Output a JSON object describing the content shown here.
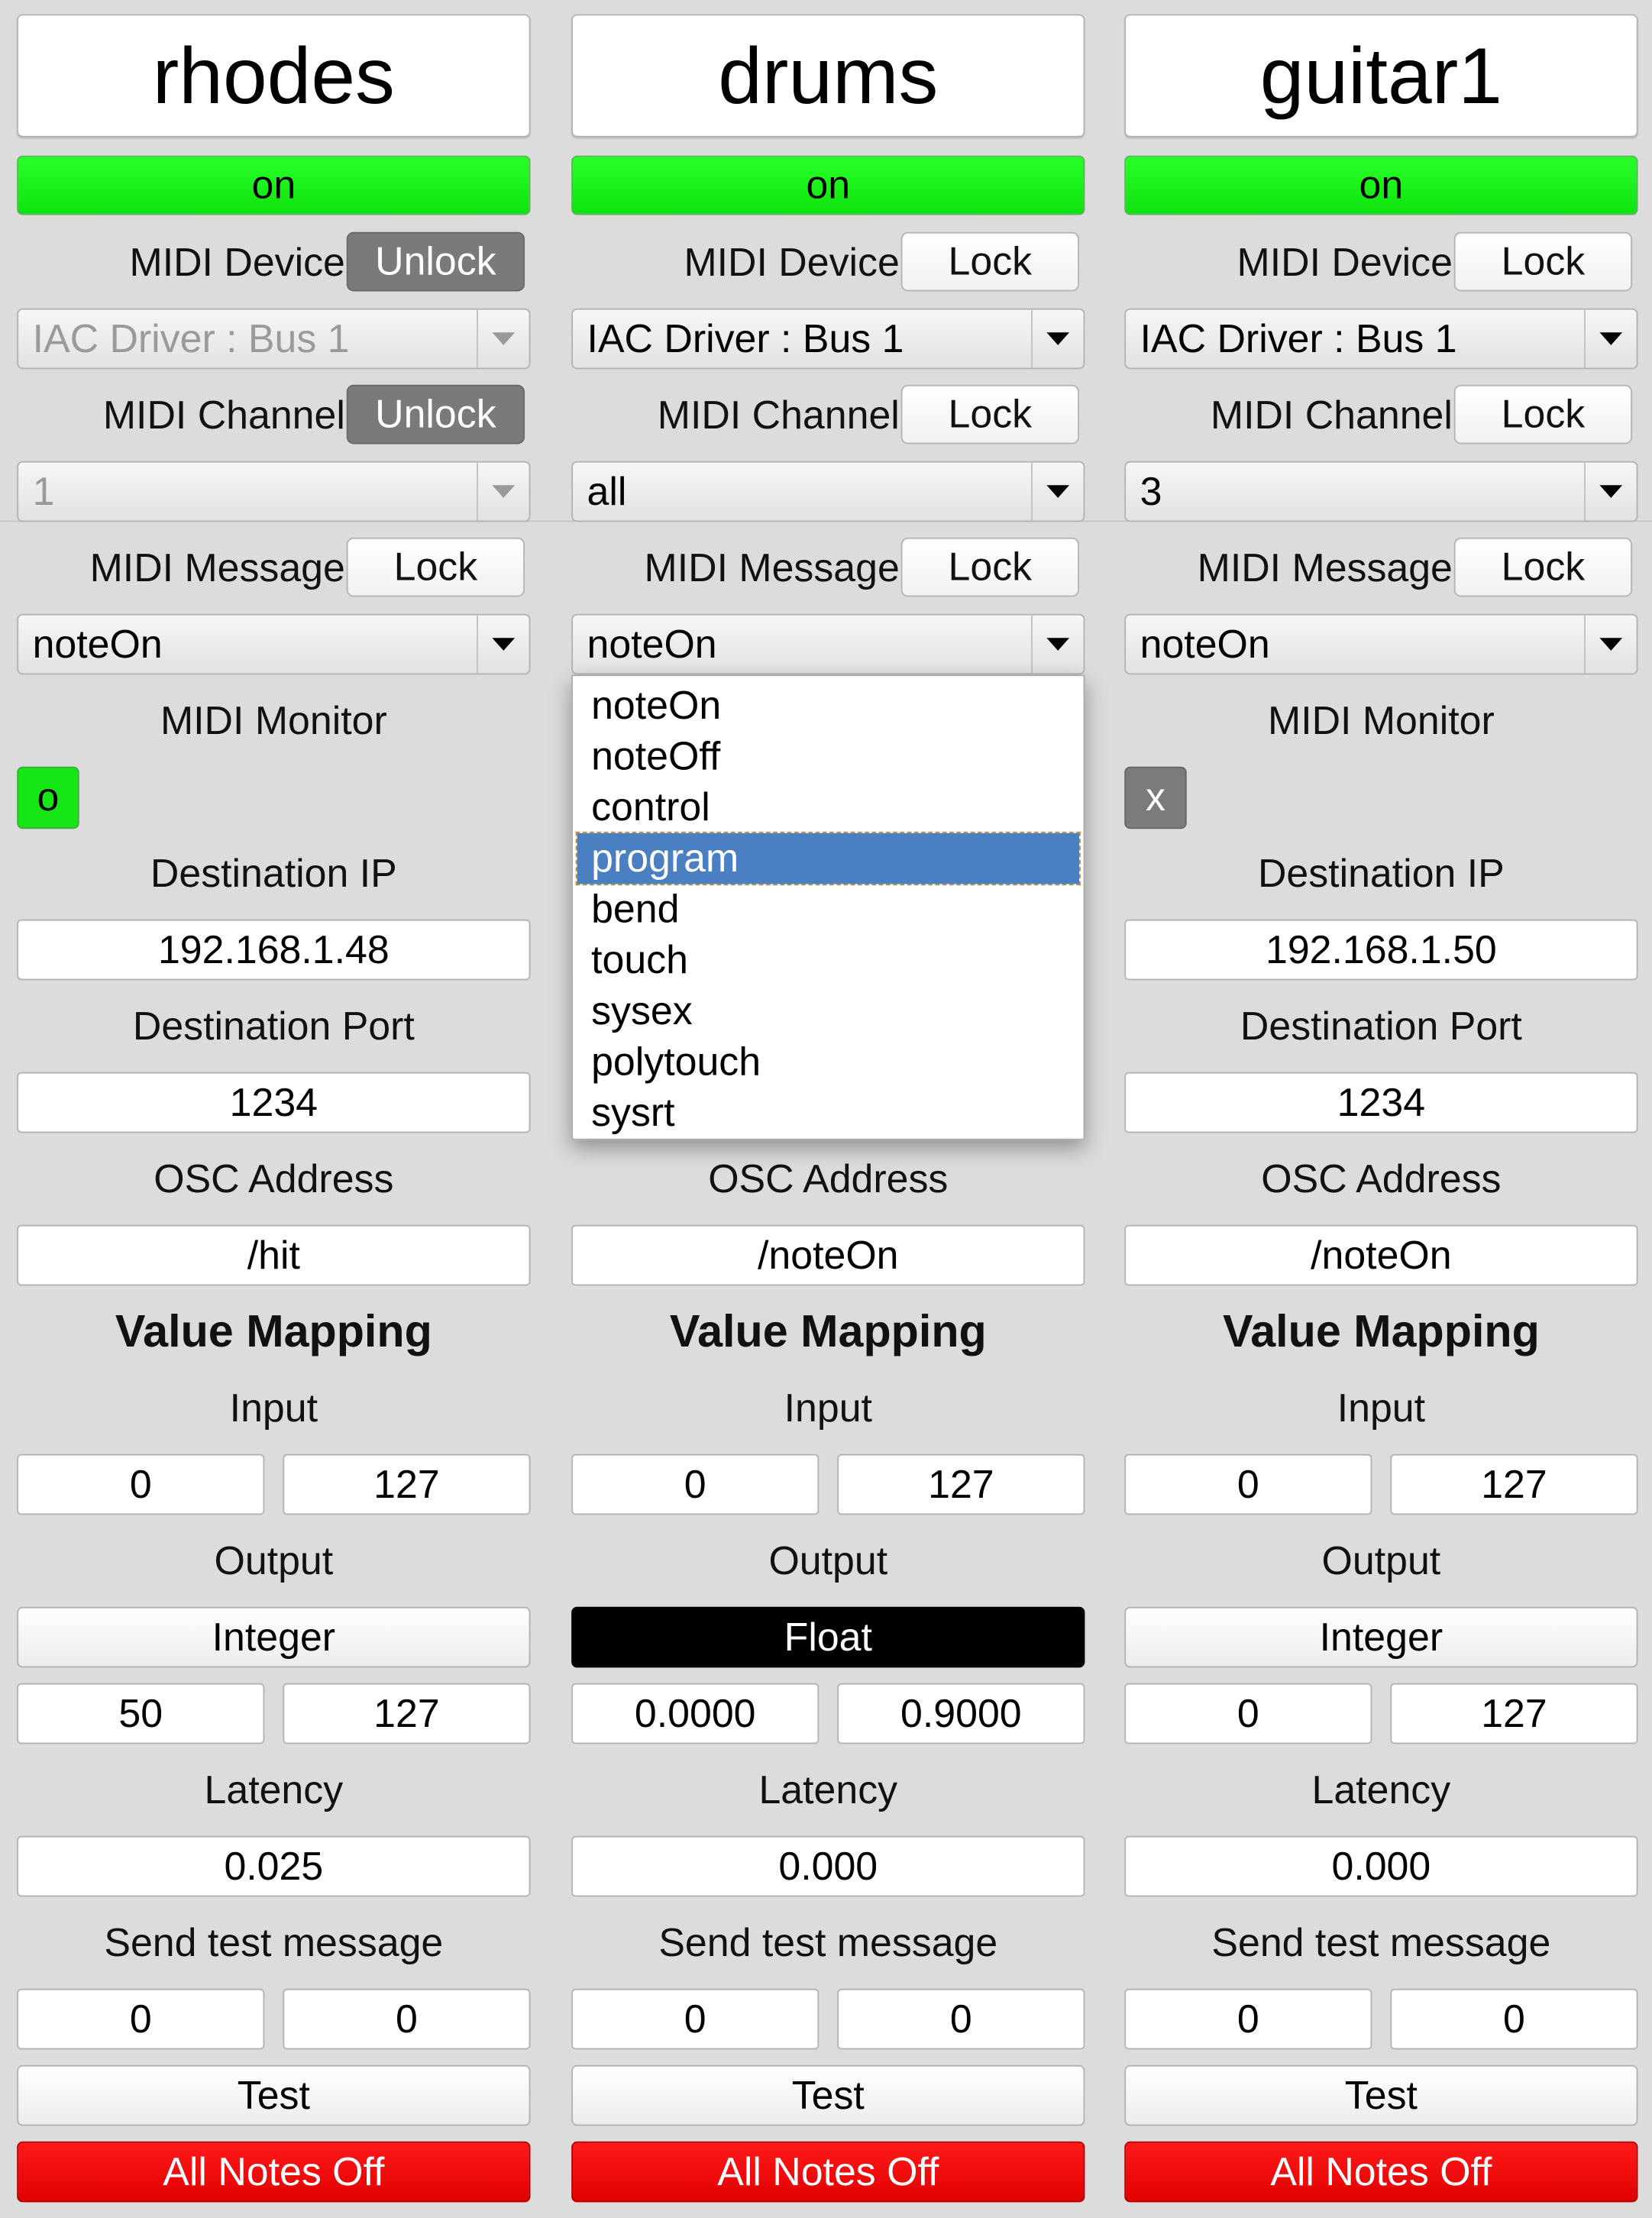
{
  "columns": [
    {
      "name": "rhodes",
      "state": "on",
      "device_label": "MIDI Device",
      "device_lock": "Unlock",
      "device_value": "IAC Driver : Bus 1",
      "channel_label": "MIDI Channel",
      "channel_lock": "Unlock",
      "channel_value": "1",
      "message_label": "MIDI Message",
      "message_lock": "Lock",
      "message_value": "noteOn",
      "monitor_label": "MIDI Monitor",
      "monitor_value": "o",
      "monitor_state": "active",
      "ip_label": "Destination IP",
      "ip": "192.168.1.48",
      "port_label": "Destination Port",
      "port": "1234",
      "osc_label": "OSC Address",
      "osc": "/hit",
      "mapping_title": "Value Mapping",
      "input_label": "Input",
      "input_min": "0",
      "input_max": "127",
      "output_label": "Output",
      "output_type": "Integer",
      "output_min": "50",
      "output_max": "127",
      "latency_label": "Latency",
      "latency": "0.025",
      "test_label": "Send test message",
      "test_a": "0",
      "test_b": "0",
      "test_button": "Test",
      "all_notes_off": "All Notes Off"
    },
    {
      "name": "drums",
      "state": "on",
      "device_label": "MIDI Device",
      "device_lock": "Lock",
      "device_value": "IAC Driver : Bus 1",
      "channel_label": "MIDI Channel",
      "channel_lock": "Lock",
      "channel_value": "all",
      "message_label": "MIDI Message",
      "message_lock": "Lock",
      "message_value": "noteOn",
      "monitor_label": "MIDI Monitor",
      "monitor_value": "",
      "monitor_state": "hidden",
      "ip_label": "Destination IP",
      "ip": "",
      "port_label": "Destination Port",
      "port": "",
      "osc_label": "OSC Address",
      "osc": "/noteOn",
      "mapping_title": "Value Mapping",
      "input_label": "Input",
      "input_min": "0",
      "input_max": "127",
      "output_label": "Output",
      "output_type": "Float",
      "output_min": "0.0000",
      "output_max": "0.9000",
      "latency_label": "Latency",
      "latency": "0.000",
      "test_label": "Send test message",
      "test_a": "0",
      "test_b": "0",
      "test_button": "Test",
      "all_notes_off": "All Notes Off"
    },
    {
      "name": "guitar1",
      "state": "on",
      "device_label": "MIDI Device",
      "device_lock": "Lock",
      "device_value": "IAC Driver : Bus 1",
      "channel_label": "MIDI Channel",
      "channel_lock": "Lock",
      "channel_value": "3",
      "message_label": "MIDI Message",
      "message_lock": "Lock",
      "message_value": "noteOn",
      "monitor_label": "MIDI Monitor",
      "monitor_value": "x",
      "monitor_state": "inactive",
      "ip_label": "Destination IP",
      "ip": "192.168.1.50",
      "port_label": "Destination Port",
      "port": "1234",
      "osc_label": "OSC Address",
      "osc": "/noteOn",
      "mapping_title": "Value Mapping",
      "input_label": "Input",
      "input_min": "0",
      "input_max": "127",
      "output_label": "Output",
      "output_type": "Integer",
      "output_min": "0",
      "output_max": "127",
      "latency_label": "Latency",
      "latency": "0.000",
      "test_label": "Send test message",
      "test_a": "0",
      "test_b": "0",
      "test_button": "Test",
      "all_notes_off": "All Notes Off"
    }
  ],
  "message_dropdown": {
    "open_in_column": 1,
    "options": [
      "noteOn",
      "noteOff",
      "control",
      "program",
      "bend",
      "touch",
      "sysex",
      "polytouch",
      "sysrt"
    ],
    "highlighted": "program"
  },
  "colors": {
    "on": "#16f016",
    "all_notes_off": "#f00000",
    "highlight": "#4a7fc1",
    "unlock": "#7a7a7a"
  }
}
